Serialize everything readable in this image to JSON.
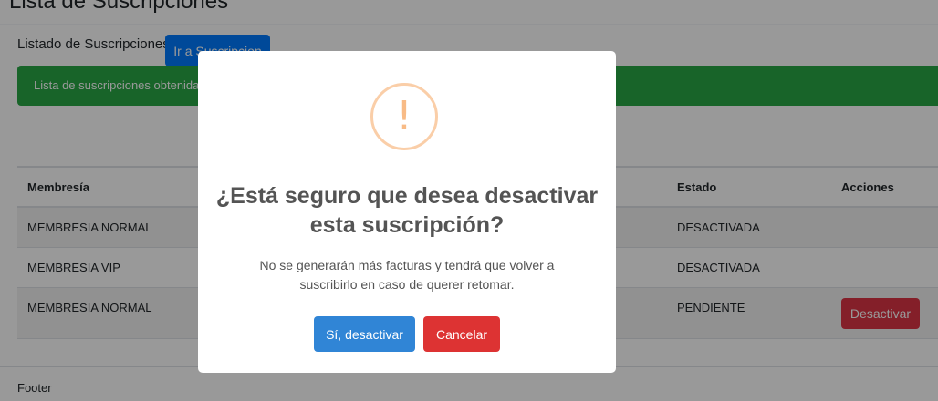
{
  "page": {
    "heading": "Lista de Suscripciones"
  },
  "card": {
    "title": "Listado de Suscripciones",
    "button_label": "Ir a Suscripcion"
  },
  "alert": {
    "text": "Lista de suscripciones obtenida"
  },
  "table": {
    "headers": {
      "membership": "Membresía",
      "status": "Estado",
      "actions": "Acciones"
    },
    "rows": [
      {
        "membership": "MEMBRESIA NORMAL",
        "status": "DESACTIVADA"
      },
      {
        "membership": "MEMBRESIA VIP",
        "status": "DESACTIVADA"
      },
      {
        "membership": "MEMBRESIA NORMAL",
        "status": "PENDIENTE",
        "action_label": "Desactivar"
      }
    ]
  },
  "footer": {
    "text": "Footer"
  },
  "modal": {
    "icon_mark": "!",
    "icon": "warning-icon",
    "title": "¿Está seguro que desea desactivar esta suscripción?",
    "text": "No se generarán más facturas y tendrá que volver a suscribirlo en caso de querer retomar.",
    "confirm_label": "Sí, desactivar",
    "cancel_label": "Cancelar"
  },
  "colors": {
    "primary": "#007bff",
    "success": "#28a745",
    "danger": "#dc3545",
    "confirm": "#3085d6",
    "cancel": "#dd3333",
    "warning": "#f8bb86"
  }
}
